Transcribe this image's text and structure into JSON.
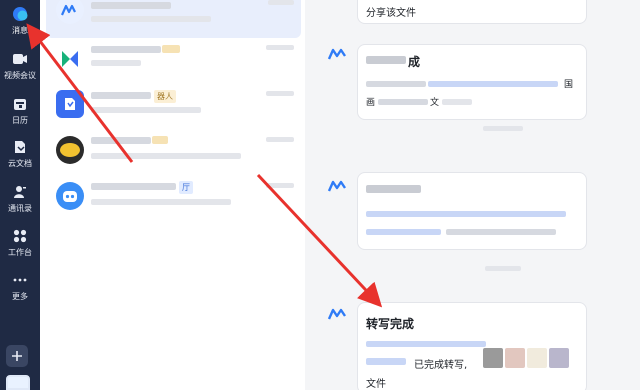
{
  "rail": {
    "items": [
      {
        "label": "消息",
        "icon": "message-icon"
      },
      {
        "label": "视频会议",
        "icon": "video-icon"
      },
      {
        "label": "日历",
        "icon": "calendar-icon"
      },
      {
        "label": "云文档",
        "icon": "document-icon"
      },
      {
        "label": "通讯录",
        "icon": "contacts-icon"
      },
      {
        "label": "工作台",
        "icon": "workspace-icon"
      },
      {
        "label": "更多",
        "icon": "more-icon"
      }
    ]
  },
  "chat_list": {
    "items": [
      {
        "tag": ""
      },
      {
        "tag": ""
      },
      {
        "tag": "器人"
      },
      {
        "tag": ""
      },
      {
        "tag": "厅"
      }
    ]
  },
  "conversation": {
    "messages": [
      {
        "text": "分享该文件"
      },
      {
        "title": "成",
        "line1_end": "国",
        "line2_start": "画",
        "line2_end": "文"
      },
      {},
      {
        "title": "转写完成",
        "status": "已完成转写,",
        "footer": "文件"
      }
    ]
  },
  "colors": {
    "rail_bg": "#1f2a44",
    "selected_bg": "#e8eefc",
    "annotation_arrow": "#e8322d"
  }
}
